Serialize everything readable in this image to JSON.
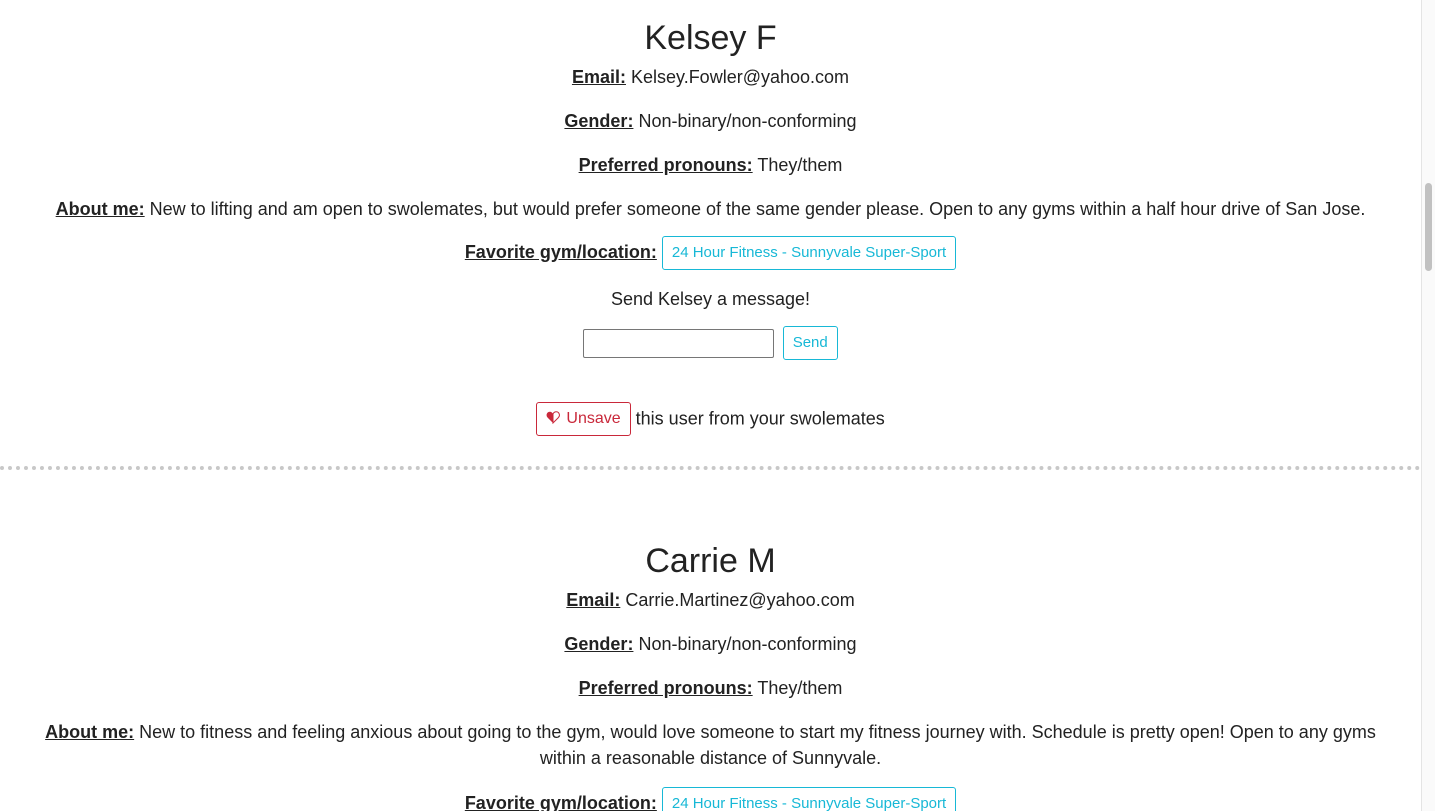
{
  "labels": {
    "email": "Email:",
    "gender": "Gender:",
    "pronouns": "Preferred pronouns:",
    "about": "About me:",
    "favorite_gym": "Favorite gym/location:"
  },
  "profiles": [
    {
      "name": "Kelsey F",
      "email": "Kelsey.Fowler@yahoo.com",
      "gender": "Non-binary/non-conforming",
      "pronouns": "They/them",
      "about": "New to lifting and am open to swolemates, but would prefer someone of the same gender please. Open to any gyms within a half hour drive of San Jose.",
      "gym": "24 Hour Fitness - Sunnyvale Super-Sport",
      "message_prompt": "Send Kelsey a message!",
      "message_value": "",
      "send_label": "Send",
      "unsave_label": "Unsave",
      "unsave_suffix": "this user from your swolemates"
    },
    {
      "name": "Carrie M",
      "email": "Carrie.Martinez@yahoo.com",
      "gender": "Non-binary/non-conforming",
      "pronouns": "They/them",
      "about": "New to fitness and feeling anxious about going to the gym, would love someone to start my fitness journey with. Schedule is pretty open! Open to any gyms within a reasonable distance of Sunnyvale.",
      "gym": "24 Hour Fitness - Sunnyvale Super-Sport"
    }
  ],
  "colors": {
    "accent": "#17b8d6",
    "danger": "#c9283a"
  },
  "icons": {
    "unsave": "heart-icon"
  }
}
